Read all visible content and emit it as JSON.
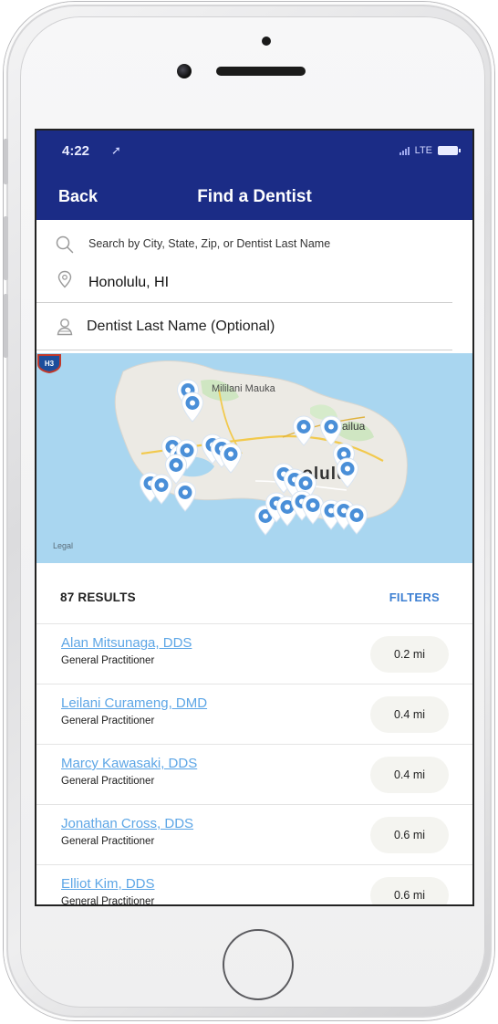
{
  "status_bar": {
    "time": "4:22",
    "location_glyph": "➚",
    "network": "LTE"
  },
  "nav": {
    "back_label": "Back",
    "title": "Find a Dentist"
  },
  "search": {
    "hint": "Search by City, State, Zip, or Dentist Last Name",
    "city_value": "Honolulu, HI",
    "last_name_placeholder": "Dentist Last Name (Optional)",
    "last_name_value": ""
  },
  "map": {
    "labels": {
      "mililani": "Mililani Mauka",
      "kailua": "ailua",
      "honolulu": "onolulu",
      "h3": "H3",
      "legal": "Legal"
    },
    "colors": {
      "water": "#a9d6f0",
      "land": "#eceae4",
      "pin": "#4a8fd8"
    }
  },
  "results": {
    "count_label": "87 RESULTS",
    "filters_label": "FILTERS",
    "items": [
      {
        "name": "Alan Mitsunaga, DDS",
        "specialty": "General Practitioner",
        "distance": "0.2 mi"
      },
      {
        "name": "Leilani Curameng, DMD",
        "specialty": "General Practitioner",
        "distance": "0.4 mi"
      },
      {
        "name": "Marcy Kawasaki, DDS",
        "specialty": "General Practitioner",
        "distance": "0.4 mi"
      },
      {
        "name": "Jonathan Cross, DDS",
        "specialty": "General Practitioner",
        "distance": "0.6 mi"
      },
      {
        "name": "Elliot Kim, DDS",
        "specialty": "General Practitioner",
        "distance": "0.6 mi"
      }
    ]
  },
  "theme": {
    "header_color": "#1b2c86",
    "link_color": "#5da6e6",
    "filters_color": "#3c7fd2"
  }
}
